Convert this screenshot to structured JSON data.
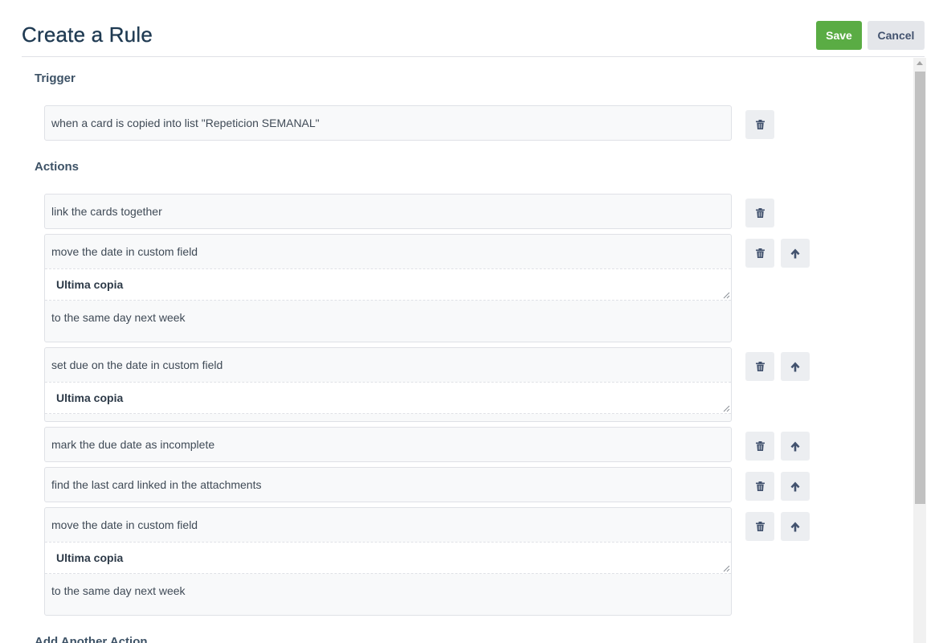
{
  "header": {
    "title": "Create a Rule",
    "save_label": "Save",
    "cancel_label": "Cancel"
  },
  "trigger": {
    "heading": "Trigger",
    "text": "when a card is copied into list \"Repeticion SEMANAL\""
  },
  "actions": {
    "heading": "Actions",
    "items": [
      {
        "text": "link the cards together"
      },
      {
        "text": "move the date in custom field",
        "field": "Ultima copia",
        "suffix": "to the same day next week"
      },
      {
        "text": "set due on the date in custom field",
        "field": "Ultima copia"
      },
      {
        "text": "mark the due date as incomplete"
      },
      {
        "text": "find the last card linked in the attachments"
      },
      {
        "text": "move the date in custom field",
        "field": "Ultima copia",
        "suffix": "to the same day next week"
      }
    ]
  },
  "add_action": {
    "heading": "Add Another Action"
  },
  "icons": {
    "delete": "trash-icon",
    "move_up": "arrow-up-icon"
  },
  "colors": {
    "save": "#5aac44",
    "cancel": "#e4e6ea",
    "title": "#1f3a52",
    "icon": "#42526e"
  }
}
